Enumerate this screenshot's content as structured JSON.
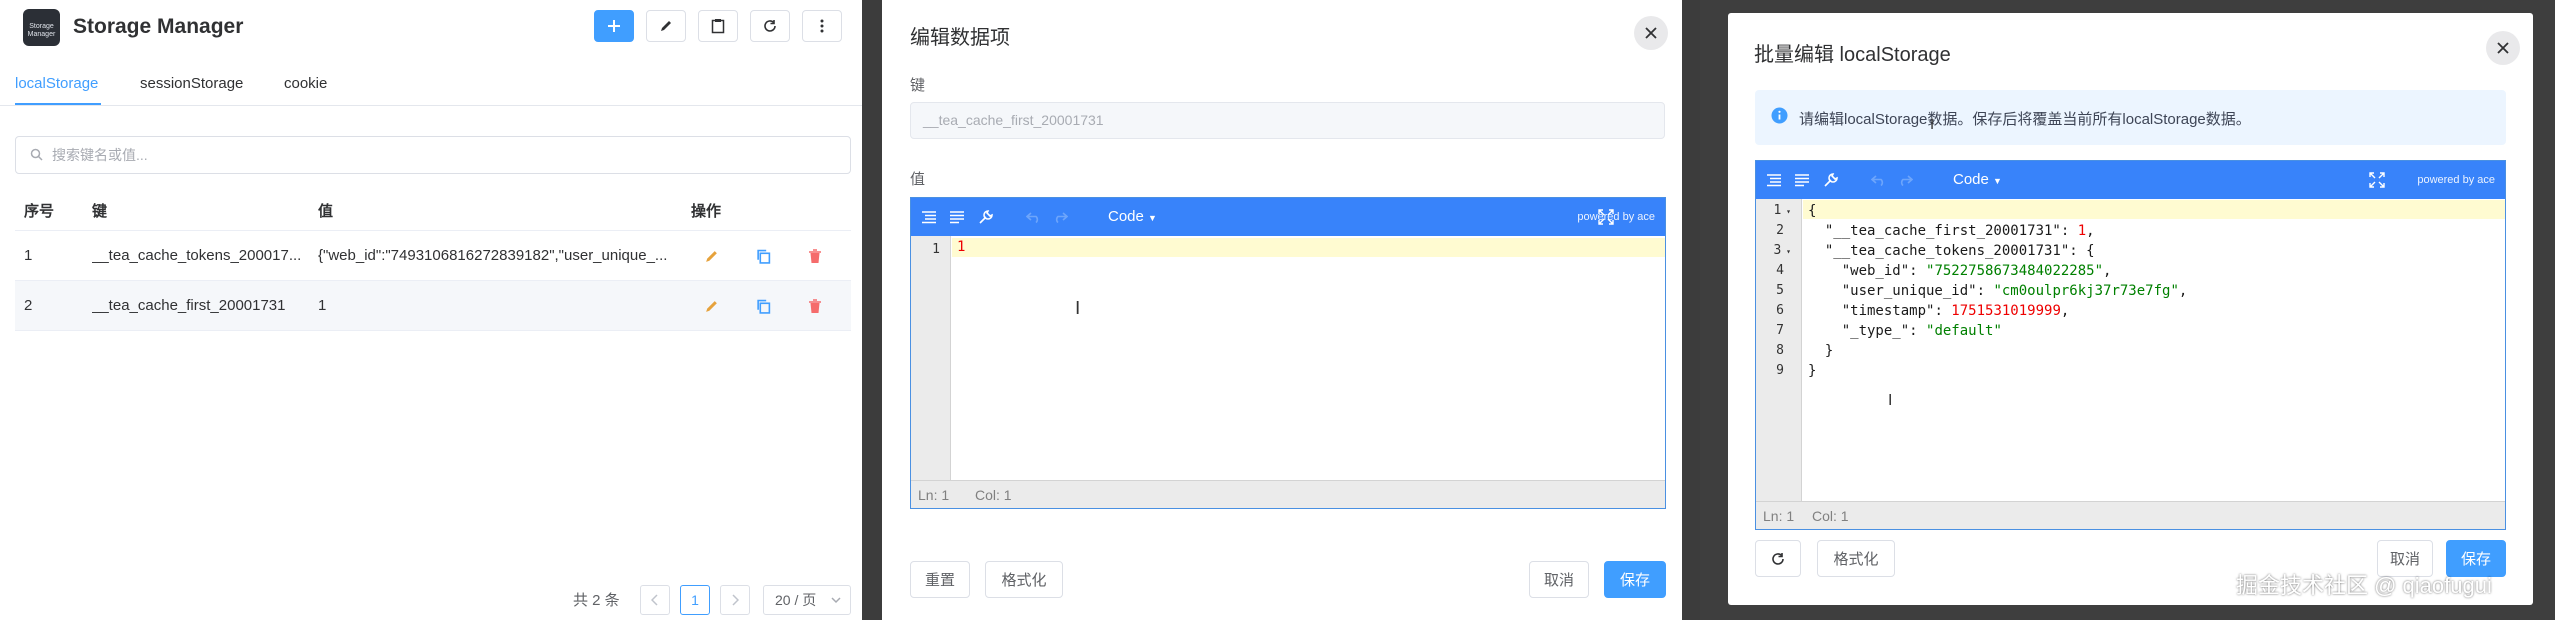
{
  "app": {
    "title": "Storage Manager",
    "logo_text": "Storage Manager"
  },
  "tabs": [
    "localStorage",
    "sessionStorage",
    "cookie"
  ],
  "search": {
    "placeholder": "搜索键名或值..."
  },
  "table": {
    "headers": [
      "序号",
      "键",
      "值",
      "操作"
    ],
    "rows": [
      {
        "index": "1",
        "key": "__tea_cache_tokens_200017...",
        "value": "{\"web_id\":\"7493106816272839182\",\"user_unique_..."
      },
      {
        "index": "2",
        "key": "__tea_cache_first_20001731",
        "value": "1"
      }
    ]
  },
  "pagination": {
    "total": "共 2 条",
    "current_page": "1",
    "page_size": "20 / 页"
  },
  "edit_dialog": {
    "title": "编辑数据项",
    "key_label": "键",
    "key_value": "__tea_cache_first_20001731",
    "value_label": "值",
    "editor": {
      "mode": "Code",
      "powered": "powered by ace",
      "lines": [
        "1"
      ],
      "line_numbers": [
        "1"
      ],
      "status_ln": "Ln: 1",
      "status_col": "Col: 1"
    },
    "reset_label": "重置",
    "format_label": "格式化",
    "cancel_label": "取消",
    "save_label": "保存"
  },
  "batch_dialog": {
    "title": "批量编辑 localStorage",
    "notice": "请编辑localStorage数据。保存后将覆盖当前所有localStorage数据。",
    "editor": {
      "mode": "Code",
      "powered": "powered by ace",
      "line_numbers": [
        "1",
        "2",
        "3",
        "4",
        "5",
        "6",
        "7",
        "8",
        "9"
      ],
      "fold_lines": [
        "1",
        "3"
      ],
      "json": {
        "first_key": "\"__tea_cache_first_20001731\"",
        "first_val": "1",
        "tokens_key": "\"__tea_cache_tokens_20001731\"",
        "web_id_key": "\"web_id\"",
        "web_id_val": "\"7522758673484022285\"",
        "uid_key": "\"user_unique_id\"",
        "uid_val": "\"cm0oulpr6kj37r73e7fg\"",
        "ts_key": "\"timestamp\"",
        "ts_val": "1751531019999",
        "type_key": "\"_type_\"",
        "type_val": "\"default\""
      },
      "status_ln": "Ln: 1",
      "status_col": "Col: 1"
    },
    "format_label": "格式化",
    "cancel_label": "取消",
    "save_label": "保存"
  },
  "watermark": "掘金技术社区 @ qiaofugui",
  "colors": {
    "primary": "#409eff",
    "editor_bar": "#3883fa",
    "edit_icon": "#e6a23c",
    "copy_icon": "#409eff",
    "delete_icon": "#f56c6c"
  }
}
